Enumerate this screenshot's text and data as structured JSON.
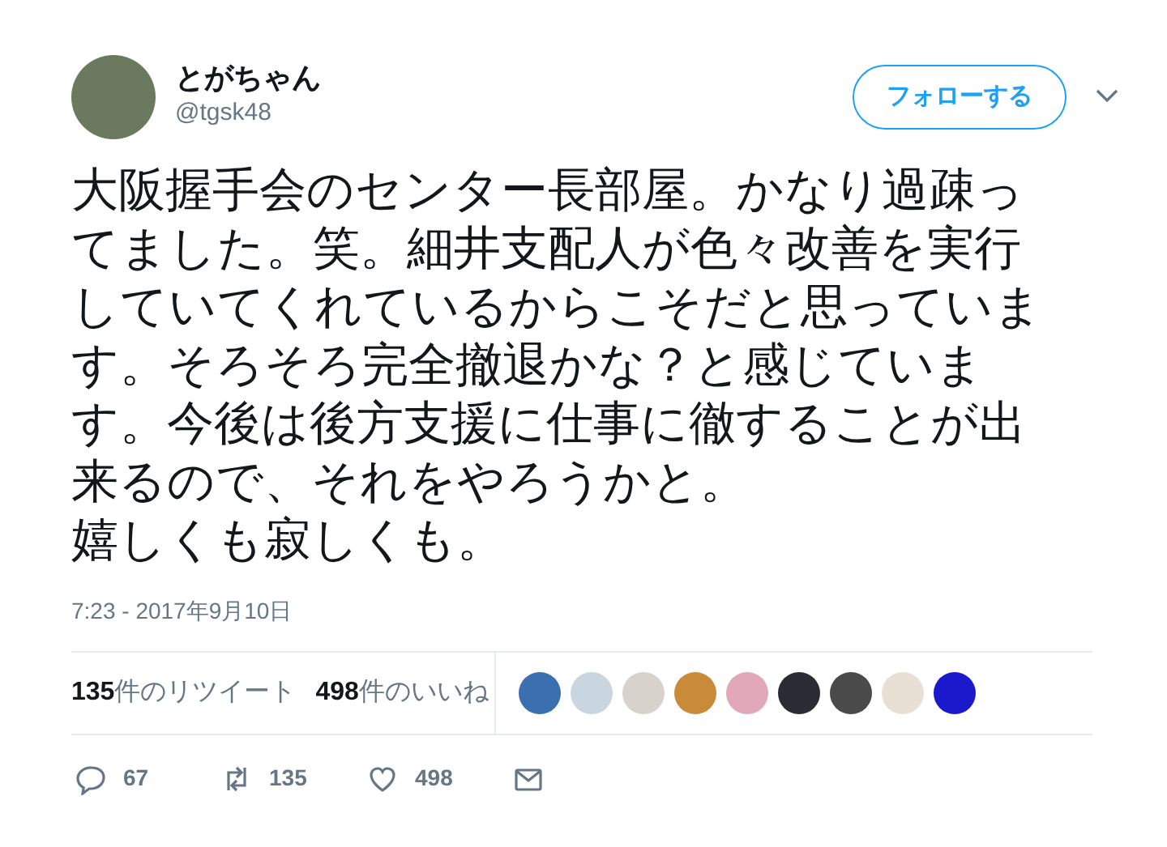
{
  "author": {
    "name": "とがちゃん",
    "handle": "@tgsk48"
  },
  "follow_button": "フォローする",
  "tweet_paragraphs": [
    "大阪握手会のセンター長部屋。かなり過疎ってました。笑。細井支配人が色々改善を実行していてくれているからこそだと思っています。そろそろ完全撤退かな？と感じています。今後は後方支援に仕事に徹することが出来るので、それをやろうかと。",
    "嬉しくも寂しくも。"
  ],
  "timestamp": "7:23 - 2017年9月10日",
  "stats": [
    "**135**件のリツイート",
    "**498**件のいいね"
  ],
  "liker_avatars": [
    {
      "kind": "photo"
    },
    {
      "kind": "photo"
    },
    {
      "kind": "photo"
    },
    {
      "kind": "photo"
    },
    {
      "kind": "photo"
    },
    {
      "kind": "photo"
    },
    {
      "kind": "photo"
    },
    {
      "kind": "photo"
    },
    {
      "kind": "plain"
    }
  ],
  "actions": [
    {
      "kind": "reply",
      "count": "67"
    },
    {
      "kind": "retweet",
      "count": "135"
    },
    {
      "kind": "like",
      "count": "498"
    },
    {
      "kind": "message"
    }
  ]
}
